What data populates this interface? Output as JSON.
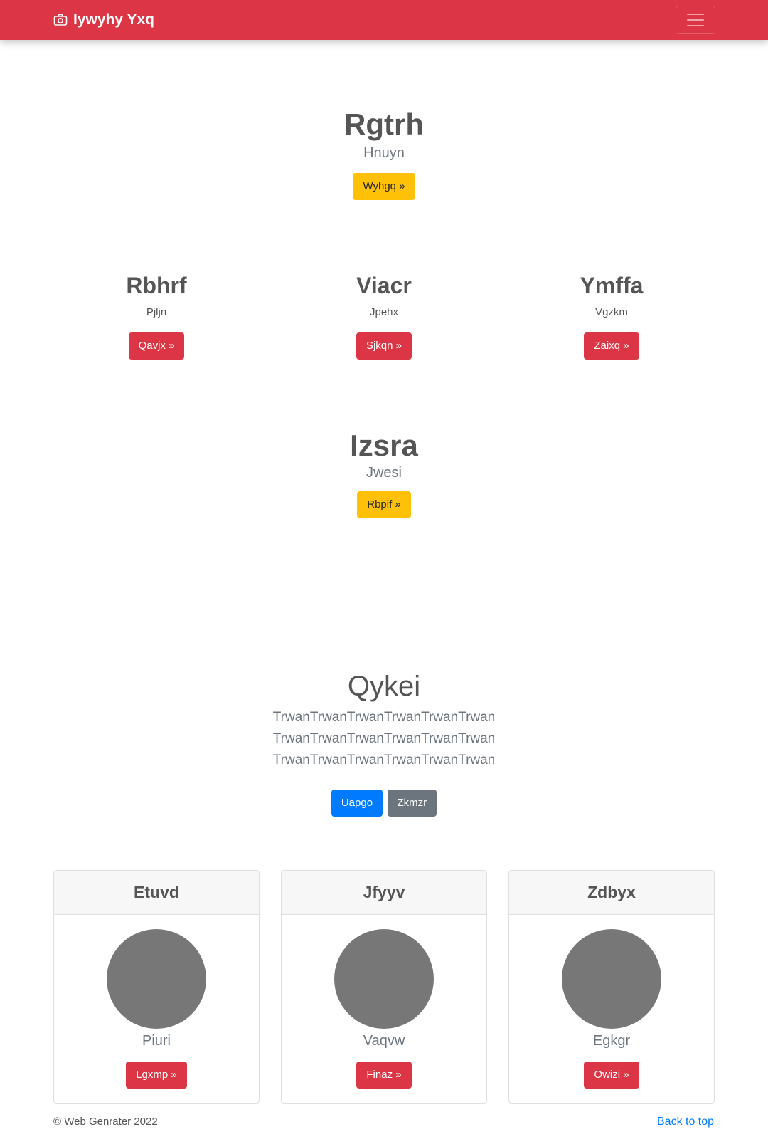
{
  "navbar": {
    "brand": "Iywyhy Yxq",
    "brand_icon": "camera-icon",
    "toggler_icon": "hamburger-menu-icon",
    "color": "#dc3545"
  },
  "hero1": {
    "title": "Rgtrh",
    "subtitle": "Hnuyn",
    "button": "Wyhgq »"
  },
  "features": [
    {
      "title": "Rbhrf",
      "text": "Pjljn",
      "button": "Qavjx »"
    },
    {
      "title": "Viacr",
      "text": "Jpehx",
      "button": "Sjkqn »"
    },
    {
      "title": "Ymffa",
      "text": "Vgzkm",
      "button": "Zaixq »"
    }
  ],
  "hero2": {
    "title": "Izsra",
    "subtitle": "Jwesi",
    "button": "Rbpif »"
  },
  "section": {
    "title": "Qykei",
    "lead": "TrwanTrwanTrwanTrwanTrwanTrwan TrwanTrwanTrwanTrwanTrwanTrwan TrwanTrwanTrwanTrwanTrwanTrwan",
    "primary_button": "Uapgo",
    "secondary_button": "Zkmzr"
  },
  "cards": [
    {
      "header": "Etuvd",
      "text": "Piuri",
      "button": "Lgxmp »"
    },
    {
      "header": "Jfyyv",
      "text": "Vaqvw",
      "button": "Finaz »"
    },
    {
      "header": "Zdbyx",
      "text": "Egkgr",
      "button": "Owizi »"
    }
  ],
  "footer": {
    "copyright": "© Web Genrater 2022",
    "back_to_top": "Back to top"
  }
}
